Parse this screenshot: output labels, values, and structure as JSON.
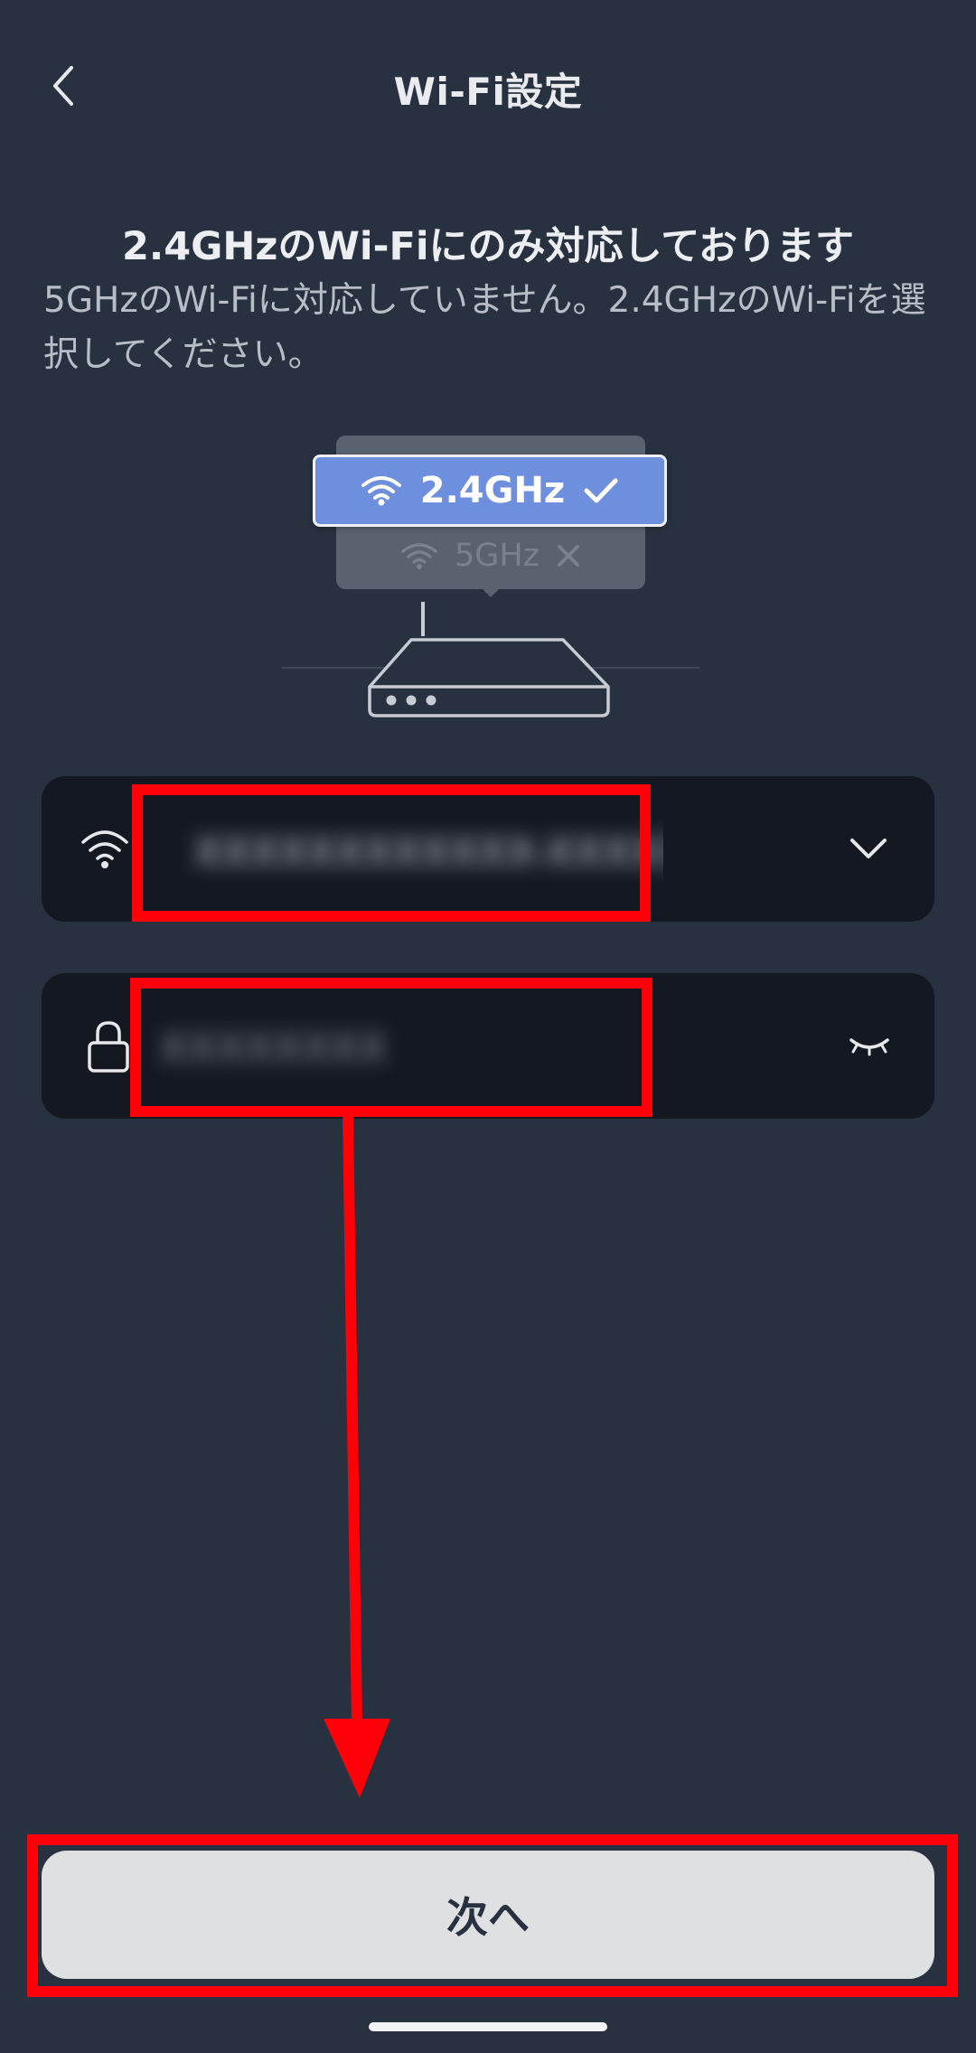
{
  "header": {
    "title": "Wi-Fi設定"
  },
  "info": {
    "title": "2.4GHzのWi-Fiにのみ対応しております",
    "description": "5GHzのWi-Fiに対応していません。2.4GHzのWi-Fiを選択してください。"
  },
  "illustration": {
    "band_supported": "2.4GHz",
    "band_unsupported": "5GHz"
  },
  "ssid_field": {
    "value": "XXXXXXXXXXXX-XXXXXX"
  },
  "password_field": {
    "value": "XXXXXXXX"
  },
  "next_button": {
    "label": "次へ"
  },
  "colors": {
    "background": "#283140",
    "field_background": "#141921",
    "highlight_band": "#6e8ede",
    "annotation_red": "#ff0008",
    "button_background": "#dfe0e2"
  }
}
